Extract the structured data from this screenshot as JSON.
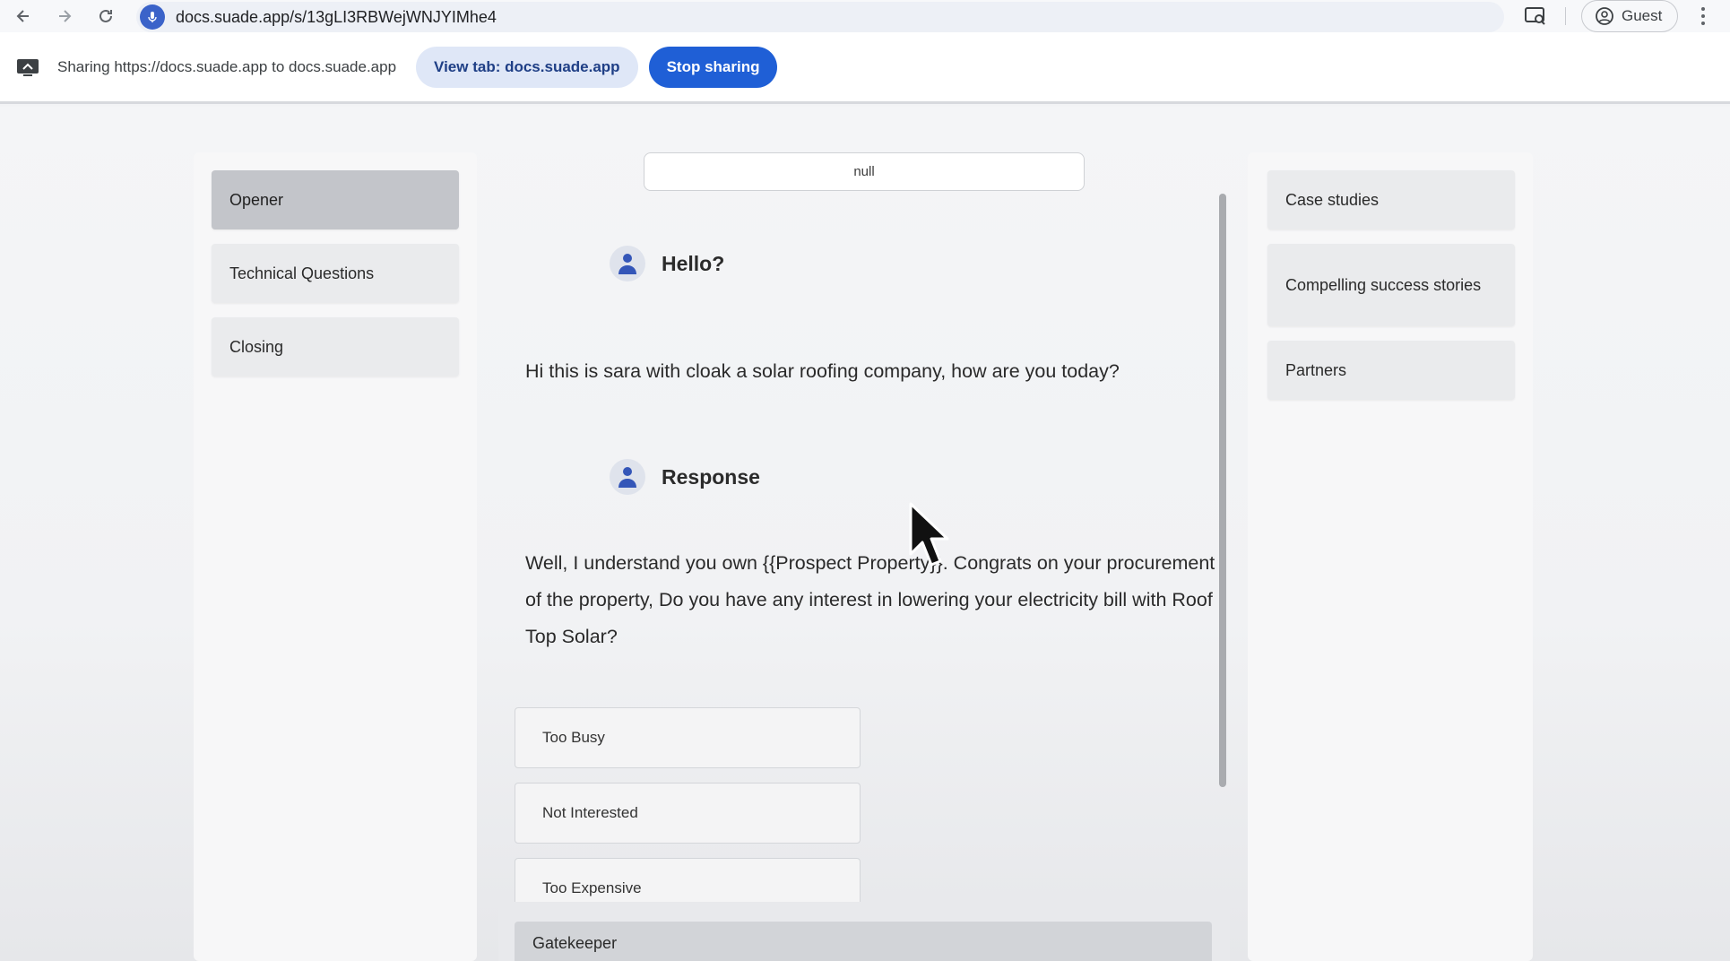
{
  "browser": {
    "url": "docs.suade.app/s/13gLI3RBWejWNJYIMhe4",
    "profile_label": "Guest"
  },
  "share_bar": {
    "text": "Sharing https://docs.suade.app to docs.suade.app",
    "view_tab_label": "View tab: docs.suade.app",
    "stop_label": "Stop sharing"
  },
  "sidebar": {
    "items": [
      {
        "label": "Opener",
        "active": true
      },
      {
        "label": "Technical Questions",
        "active": false
      },
      {
        "label": "Closing",
        "active": false
      }
    ]
  },
  "main": {
    "null_value": "null",
    "messages": [
      {
        "speaker": "Hello?",
        "text": "Hi this is sara with cloak a solar roofing company, how are you today?"
      },
      {
        "speaker": "Response",
        "text": "Well, I understand you own {{Prospect Property}}. Congrats on your procurement of the property, Do you have any interest in lowering your electricity bill with Roof Top Solar?"
      }
    ],
    "responses": [
      "Too Busy",
      "Not Interested",
      "Too Expensive"
    ],
    "gatekeeper_label": "Gatekeeper"
  },
  "resources": {
    "items": [
      "Case studies",
      "Compelling success stories",
      "Partners"
    ]
  },
  "colors": {
    "accent": "#1f5fd6",
    "active_nav": "#c3c5ca"
  }
}
